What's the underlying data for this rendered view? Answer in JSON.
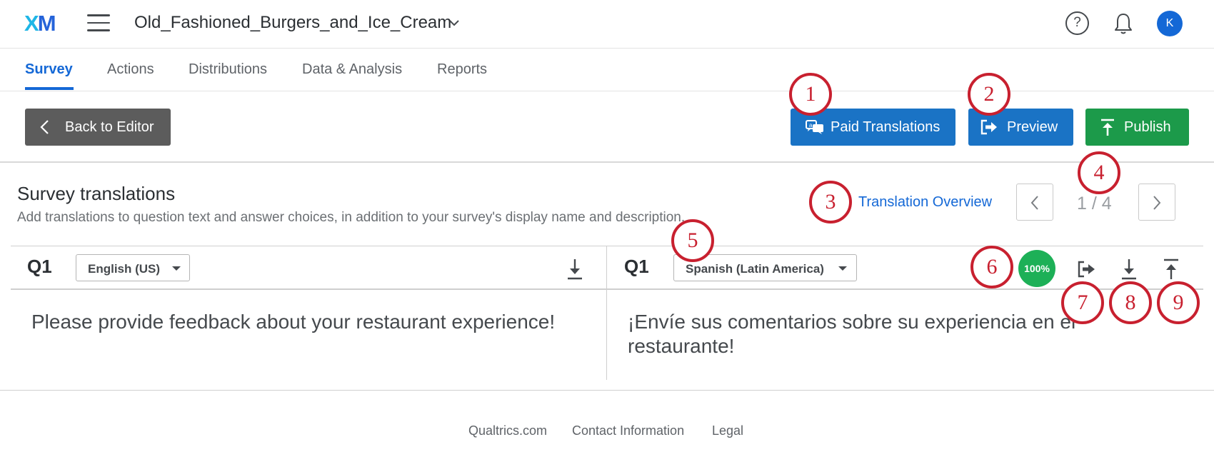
{
  "header": {
    "logo_x": "X",
    "logo_m": "M",
    "project_title": "Old_Fashioned_Burgers_and_Ice_Cream",
    "help_glyph": "?",
    "avatar_initial": "K",
    "icons": [
      "hamburger-menu-icon",
      "chevron-down-icon",
      "help-icon",
      "bell-icon"
    ]
  },
  "tabs": [
    {
      "label": "Survey",
      "active": true
    },
    {
      "label": "Actions",
      "active": false
    },
    {
      "label": "Distributions",
      "active": false
    },
    {
      "label": "Data & Analysis",
      "active": false
    },
    {
      "label": "Reports",
      "active": false
    }
  ],
  "toolbar": {
    "back_label": "Back to Editor",
    "paid_translations_label": "Paid Translations",
    "preview_label": "Preview",
    "publish_label": "Publish"
  },
  "translations": {
    "title": "Survey translations",
    "description": "Add translations to question text and answer choices, in addition to your survey's display name and description.",
    "overview_link": "Translation Overview",
    "pager": "1 / 4"
  },
  "source_panel": {
    "question_id": "Q1",
    "language": "English (US)",
    "text": "Please provide feedback about your restaurant experience!"
  },
  "target_panel": {
    "question_id": "Q1",
    "language": "Spanish (Latin America)",
    "progress": "100%",
    "text_line1": "¡Envíe sus comentarios sobre su experiencia en el",
    "text_line2": "restaurante!"
  },
  "callouts": [
    "1",
    "2",
    "3",
    "4",
    "5",
    "6",
    "7",
    "8",
    "9"
  ],
  "footer": {
    "links": [
      "Qualtrics.com",
      "Contact Information",
      "Legal"
    ]
  },
  "colors": {
    "primary_blue": "#1a73c5",
    "publish_green": "#1c9a4a",
    "progress_green": "#1db057",
    "callout_red": "#c8202f",
    "back_button_gray": "#5c5c5c"
  }
}
